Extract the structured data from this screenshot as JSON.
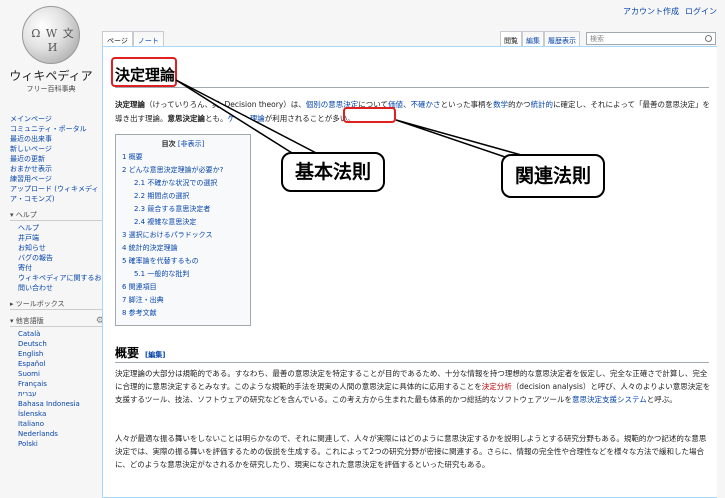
{
  "personal": {
    "account": "アカウント作成",
    "login": "ログイン"
  },
  "logo": {
    "title": "ウィキペディア",
    "subtitle": "フリー百科事典"
  },
  "sidebar": {
    "nav": [
      "メインページ",
      "コミュニティ・ポータル",
      "最近の出来事",
      "新しいページ",
      "最近の更新",
      "おまかせ表示",
      "練習用ページ",
      "アップロード (ウィキメディア・コモンズ)"
    ],
    "help": {
      "header": "ヘルプ",
      "items": [
        "ヘルプ",
        "井戸端",
        "お知らせ",
        "バグの報告",
        "寄付",
        "ウィキペディアに関するお問い合わせ"
      ]
    },
    "toolbox": {
      "header": "ツールボックス"
    },
    "languages": {
      "header": "他言語版",
      "items": [
        "Català",
        "Deutsch",
        "English",
        "Español",
        "Suomi",
        "Français",
        "עברית",
        "Bahasa Indonesia",
        "Íslenska",
        "Italiano",
        "Nederlands",
        "Polski"
      ]
    }
  },
  "tabs": {
    "page": "ページ",
    "note": "ノート",
    "read": "閲覧",
    "edit": "編集",
    "history": "履歴表示"
  },
  "search": {
    "placeholder": "検索"
  },
  "article": {
    "title": "決定理論",
    "intro": {
      "lead_bold": "決定理論",
      "p1": "（けっていりろん、英: Decision theory）は、",
      "l1": "個別の意思決定",
      "p2": "について",
      "l2": "価値",
      "p3": "、",
      "l3": "不確かさ",
      "p4": "といった事柄を",
      "l4": "数学",
      "p5": "的かつ",
      "l5": "統計的",
      "p6": "に確定し、それによって「最善の意思決定」を導き出す理論。",
      "b2": "意思決定論",
      "p7": "とも。",
      "l6": "ゲーム理論",
      "p8": "が利用されることが多い。"
    },
    "toc": {
      "title": "目次",
      "toggle": "[非表示]",
      "entries": [
        {
          "text": "1 概要",
          "level": 1
        },
        {
          "text": "2 どんな意思決定理論が必要か?",
          "level": 1
        },
        {
          "text": "2.1 不確かな状況での選択",
          "level": 2
        },
        {
          "text": "2.2 期間点の選択",
          "level": 2
        },
        {
          "text": "2.3 競合する意思決定者",
          "level": 2
        },
        {
          "text": "2.4 複雑な意思決定",
          "level": 2
        },
        {
          "text": "3 選択におけるパラドックス",
          "level": 1
        },
        {
          "text": "4 統計的決定理論",
          "level": 1
        },
        {
          "text": "5 確率論を代替するもの",
          "level": 1
        },
        {
          "text": "5.1 一般的な批判",
          "level": 2
        },
        {
          "text": "6 関連項目",
          "level": 1
        },
        {
          "text": "7 脚注・出典",
          "level": 1
        },
        {
          "text": "8 参考文献",
          "level": 1
        }
      ]
    },
    "overview": {
      "heading": "概要",
      "edit": "[編集]",
      "para1": {
        "p1": "決定理論の大部分は規範的である。すなわち、最善の意思決定を特定することが目的であるため、十分な情報を持つ理想的な意思決定者を仮定し、完全な正確さで計算し、完全に合理的に意思決定するとみなす。このような規範的手法を現実の人間の意思決定に具体的に応用することを",
        "r1": "決定分析",
        "p2": "（decision analysis）と呼び、人々のよりよい意思決定を支援するツール、技法、ソフトウェアの研究などを含んでいる。この考え方から生まれた最も体系的かつ総括的なソフトウェアツールを",
        "l1": "意思決定支援システム",
        "p3": "と呼ぶ。"
      },
      "para2": "人々が最適な振る舞いをしないことは明らかなので、それに関連して、人々が実際にはどのように意思決定するかを説明しようとする研究分野もある。規範的かつ記述的な意思決定では、実際の振る舞いを評価するための仮説を生成する。これによって2つの研究分野が密接に関連する。さらに、情報の完全性や合理性などを様々な方法で緩和した場合に、どのような意思決定がなされるかを研究したり、現実になされた意思決定を評価するといった研究もある。"
    }
  },
  "annotations": {
    "basic": "基本法則",
    "related": "関連法則"
  },
  "colors": {
    "annotation_box": "#e02020",
    "link": "#0645ad",
    "red_link": "#ba0000"
  }
}
